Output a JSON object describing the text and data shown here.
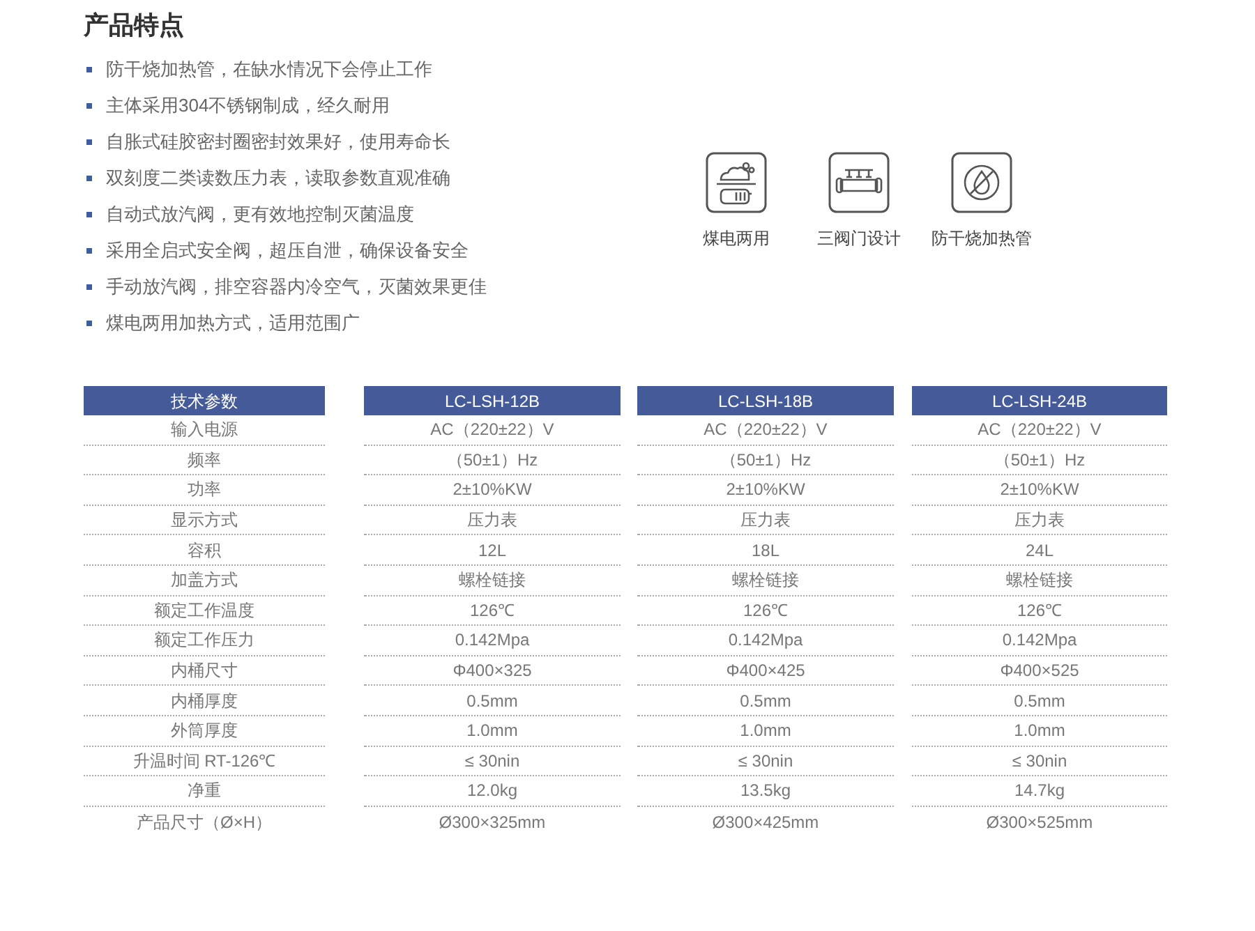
{
  "title": "产品特点",
  "features": [
    "防干烧加热管，在缺水情况下会停止工作",
    "主体采用304不锈钢制成，经久耐用",
    "自胀式硅胶密封圈密封效果好，使用寿命长",
    "双刻度二类读数压力表，读取参数直观准确",
    "自动式放汽阀，更有效地控制灭菌温度",
    "采用全启式安全阀，超压自泄，确保设备安全",
    "手动放汽阀，排空容器内冷空气，灭菌效果更佳",
    "煤电两用加热方式，适用范围广"
  ],
  "highlights": [
    {
      "kind": "coal-electric",
      "label": "煤电两用"
    },
    {
      "kind": "three-valve",
      "label": "三阀门设计"
    },
    {
      "kind": "dry-burn",
      "label": "防干烧加热管"
    }
  ],
  "table": {
    "columns": [
      "技术参数",
      "LC-LSH-12B",
      "LC-LSH-18B",
      "LC-LSH-24B"
    ],
    "rows": [
      [
        "输入电源",
        "AC（220±22）V",
        "AC（220±22）V",
        "AC（220±22）V"
      ],
      [
        "频率",
        "（50±1）Hz",
        "（50±1）Hz",
        "（50±1）Hz"
      ],
      [
        "功率",
        "2±10%KW",
        "2±10%KW",
        "2±10%KW"
      ],
      [
        "显示方式",
        "压力表",
        "压力表",
        "压力表"
      ],
      [
        "容积",
        "12L",
        "18L",
        "24L"
      ],
      [
        "加盖方式",
        "螺栓链接",
        "螺栓链接",
        "螺栓链接"
      ],
      [
        "额定工作温度",
        "126℃",
        "126℃",
        "126℃"
      ],
      [
        "额定工作压力",
        "0.142Mpa",
        "0.142Mpa",
        "0.142Mpa"
      ],
      [
        "内桶尺寸",
        "Φ400×325",
        "Φ400×425",
        "Φ400×525"
      ],
      [
        "内桶厚度",
        "0.5mm",
        "0.5mm",
        "0.5mm"
      ],
      [
        "外筒厚度",
        "1.0mm",
        "1.0mm",
        "1.0mm"
      ],
      [
        "升温时间 RT-126℃",
        "≤ 30nin",
        "≤ 30nin",
        "≤ 30nin"
      ],
      [
        "净重",
        "12.0kg",
        "13.5kg",
        "14.7kg"
      ],
      [
        "产品尺寸（Ø×H）",
        "Ø300×325mm",
        "Ø300×425mm",
        "Ø300×525mm"
      ]
    ]
  }
}
